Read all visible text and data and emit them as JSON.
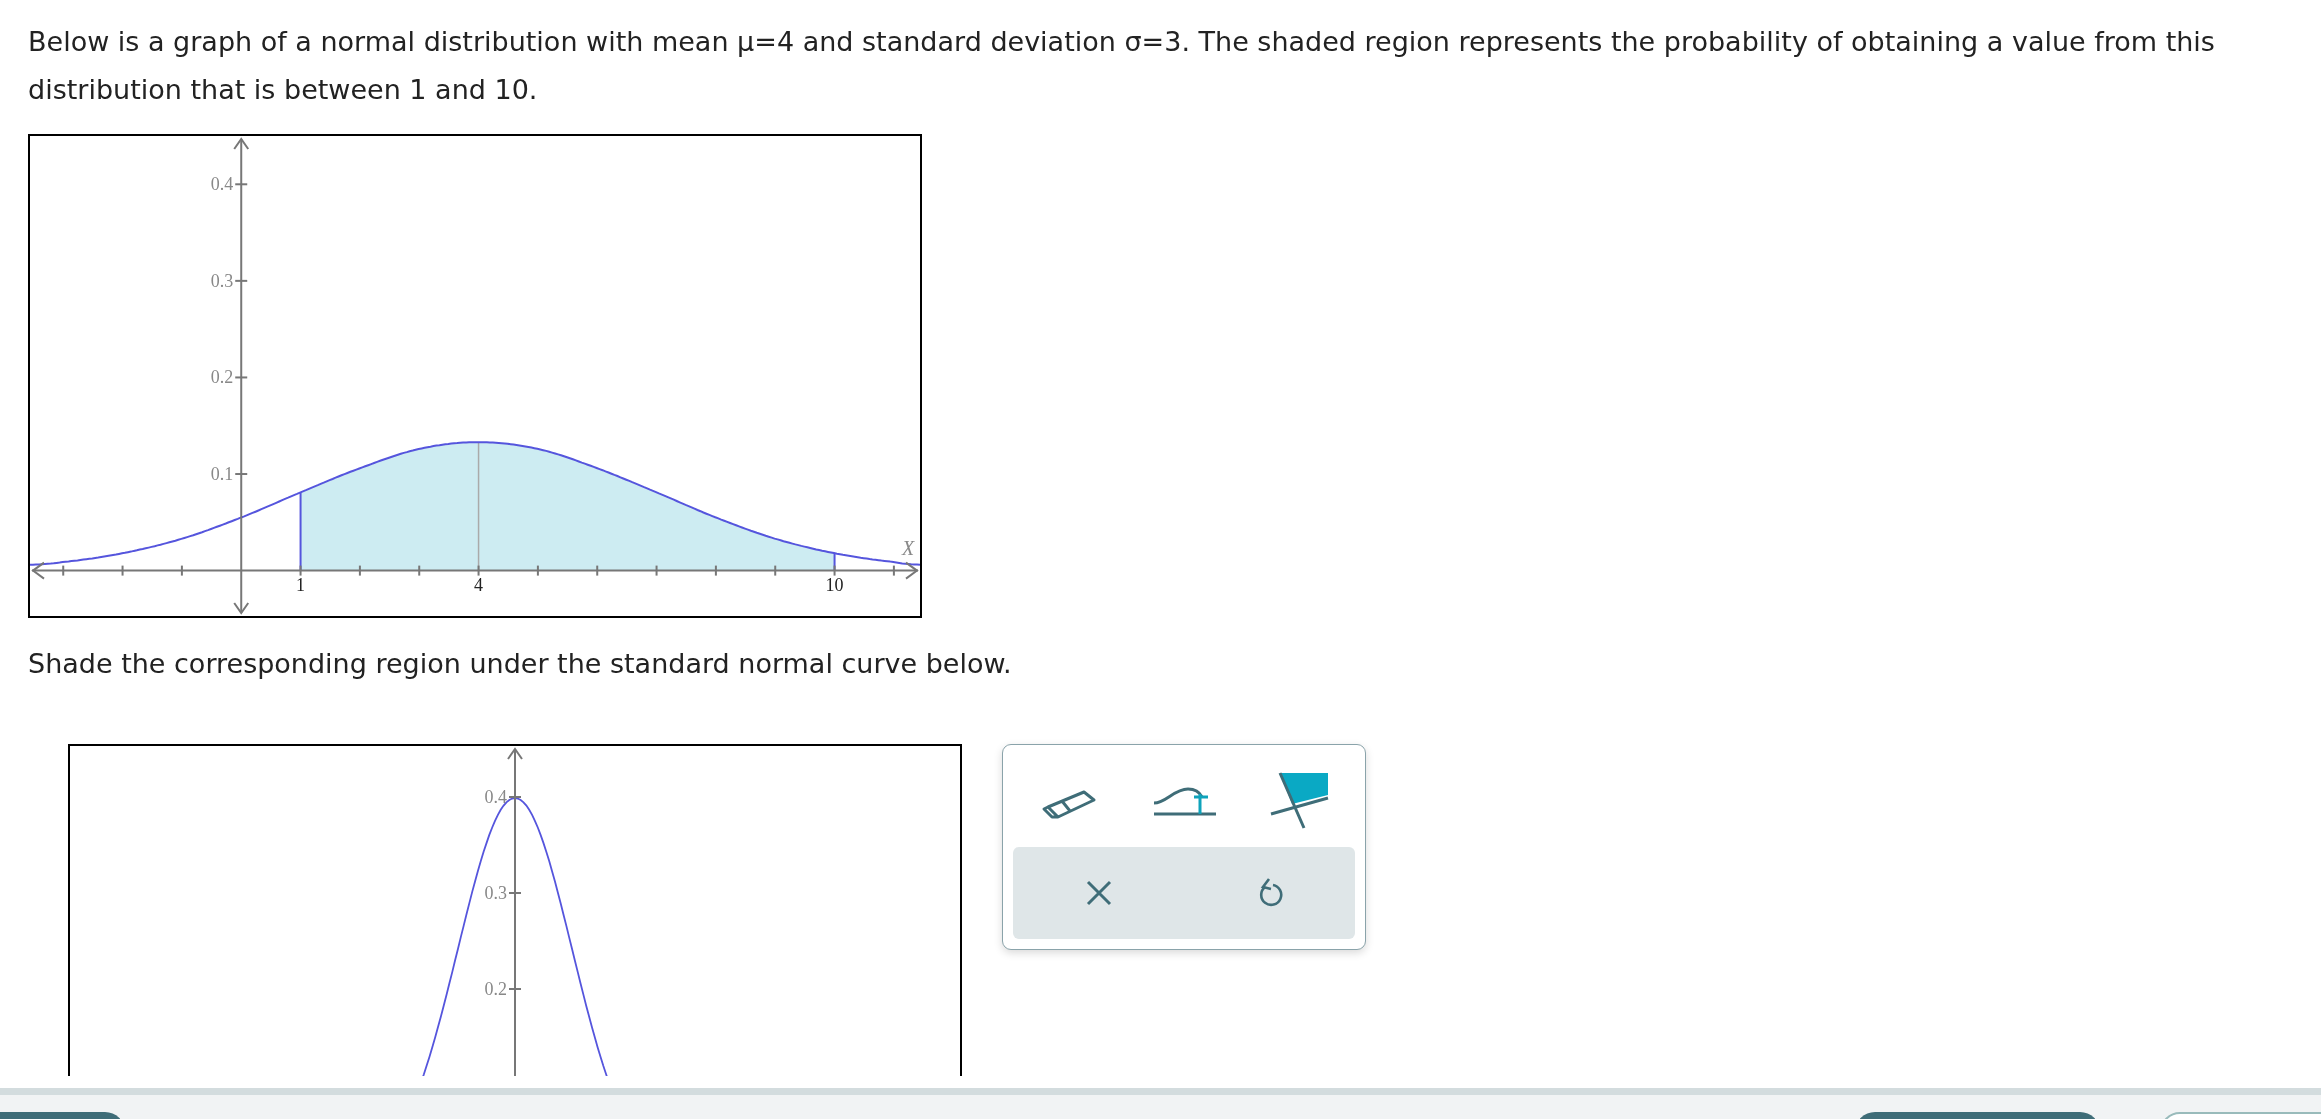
{
  "prompt": "Below is a graph of a normal distribution with mean μ=4 and standard deviation σ=3. The shaded region represents the probability of obtaining a value from this distribution that is between 1 and 10.",
  "given_graph": {
    "chart_data": {
      "type": "line",
      "xlabel": "X",
      "x": [
        -3.56,
        -3,
        -2,
        -1,
        0,
        1,
        2,
        3,
        4,
        5,
        6,
        7,
        8,
        9,
        10,
        11,
        11.44
      ],
      "values": [
        0.006,
        0.009,
        0.018,
        0.033,
        0.055,
        0.081,
        0.106,
        0.126,
        0.133,
        0.126,
        0.106,
        0.081,
        0.055,
        0.033,
        0.018,
        0.009,
        0.006
      ],
      "xlim": [
        -3.56,
        11.44
      ],
      "ylim": [
        -0.047,
        0.45
      ],
      "xticks": [
        {
          "value": 1,
          "label": "1"
        },
        {
          "value": 4,
          "label": "4"
        },
        {
          "value": 10,
          "label": "10"
        }
      ],
      "yticks": [
        {
          "value": 0.1,
          "label": "0.1"
        },
        {
          "value": 0.2,
          "label": "0.2"
        },
        {
          "value": 0.3,
          "label": "0.3"
        },
        {
          "value": 0.4,
          "label": "0.4"
        }
      ]
    }
  },
  "instruction": "Shade the corresponding region under the standard normal curve below.",
  "answer_graph": {
    "y_tick_labels": [
      "0.4",
      "0.3",
      "0.2"
    ]
  },
  "tools": [
    {
      "kind": "eraser"
    },
    {
      "kind": "curve"
    },
    {
      "kind": "shade"
    }
  ],
  "actions": [
    {
      "kind": "clear"
    },
    {
      "kind": "undo"
    }
  ]
}
